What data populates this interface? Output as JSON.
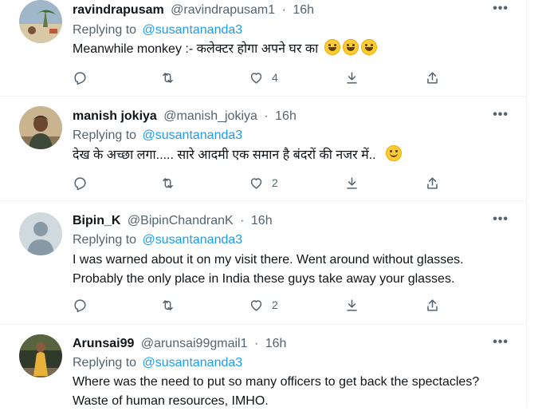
{
  "tweets": [
    {
      "name": "ravindrapusam",
      "handle": "@ravindrapusam1",
      "time": "16h",
      "replying_prefix": "Replying to",
      "replying_to": "@susantananda3",
      "text": "Meanwhile monkey :- कलेक्टर होगा अपने घर का",
      "emoji": [
        "grinning-squinting-face",
        "grinning-squinting-face",
        "grinning-squinting-face"
      ],
      "counts": {
        "reply": "",
        "retweet": "",
        "like": "4"
      }
    },
    {
      "name": "manish jokiya",
      "handle": "@manish_jokiya",
      "time": "16h",
      "replying_prefix": "Replying to",
      "replying_to": "@susantananda3",
      "text": "देख के अच्छा लगा..... सारे आदमी एक समान है बंदरों की नजर में..",
      "emoji": [
        "slightly-smiling-face"
      ],
      "counts": {
        "reply": "",
        "retweet": "",
        "like": "2"
      }
    },
    {
      "name": "Bipin_K",
      "handle": "@BipinChandranK",
      "time": "16h",
      "replying_prefix": "Replying to",
      "replying_to": "@susantananda3",
      "text_lines": [
        "I was warned about it on my visit there. Went around without glasses.",
        "Probably the only place in India these guys take away your glasses."
      ],
      "counts": {
        "reply": "",
        "retweet": "",
        "like": "2"
      }
    },
    {
      "name": "Arunsai99",
      "handle": "@arunsai99gmail1",
      "time": "16h",
      "replying_prefix": "Replying to",
      "replying_to": "@susantananda3",
      "text_lines": [
        "Where was the need to put so many officers to get back the spectacles?",
        "Waste of human resources,  IMHO."
      ]
    }
  ],
  "separator": "·",
  "more_label": "•••",
  "colors": {
    "link": "#1d9bf0",
    "muted": "#536471",
    "text": "#0f1419",
    "divider": "#eff3f4"
  },
  "icons": [
    "reply-icon",
    "retweet-icon",
    "like-icon",
    "share-down-icon",
    "share-up-icon",
    "more-icon"
  ]
}
